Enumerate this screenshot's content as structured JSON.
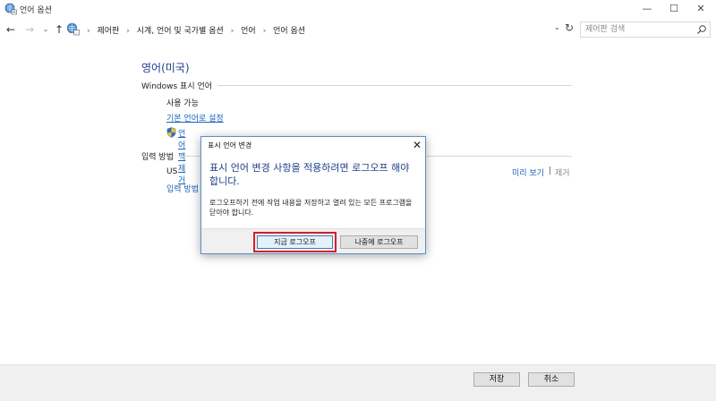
{
  "window": {
    "title": "언어 옵션",
    "minimize": "—",
    "maximize": "☐",
    "close": "✕"
  },
  "nav": {
    "back": "←",
    "forward": "→",
    "recent": "⌄",
    "up": "↑",
    "breadcrumb": [
      "제어판",
      "시계, 언어 및 국가별 옵션",
      "언어",
      "언어 옵션"
    ],
    "breadcrumb_sep": "›",
    "dropdown": "⌄",
    "refresh": "↻",
    "search_placeholder": "제어판 검색"
  },
  "main": {
    "page_title": "영어(미국)",
    "windows_lang_head": "Windows 표시 언어",
    "status_available": "사용 가능",
    "set_default_link": "기본 언어로 설정",
    "remove_lang_text": "언어 팩 제거",
    "input_method_head": "입력 방법",
    "ime_name": "US",
    "ime_add_link": "입력 방법 추가",
    "preview_link": "미리 보기",
    "pipe_sep": "|",
    "remove_ime_link": "제거"
  },
  "footer": {
    "save_label": "저장",
    "cancel_label": "취소"
  },
  "dialog": {
    "title": "표시 언어 변경",
    "close": "✕",
    "heading": "표시 언어 변경 사항을 적용하려면 로그오프 해야 합니다.",
    "body": "로그오프하기 전에 작업 내용을 저장하고 열려 있는 모든 프로그램을 닫아야 합니다.",
    "logoff_now_label": "지금 로그오프",
    "logoff_later_label": "나중에 로그오프"
  },
  "colors": {
    "heading_blue": "#1e3f8a",
    "link_blue": "#1a62b8",
    "highlight_red": "#d4202a",
    "dialog_border": "#5b8fc9"
  },
  "icons": {
    "app": "control-panel-language-icon",
    "shield": "uac-shield-icon",
    "search": "magnifier-icon"
  }
}
